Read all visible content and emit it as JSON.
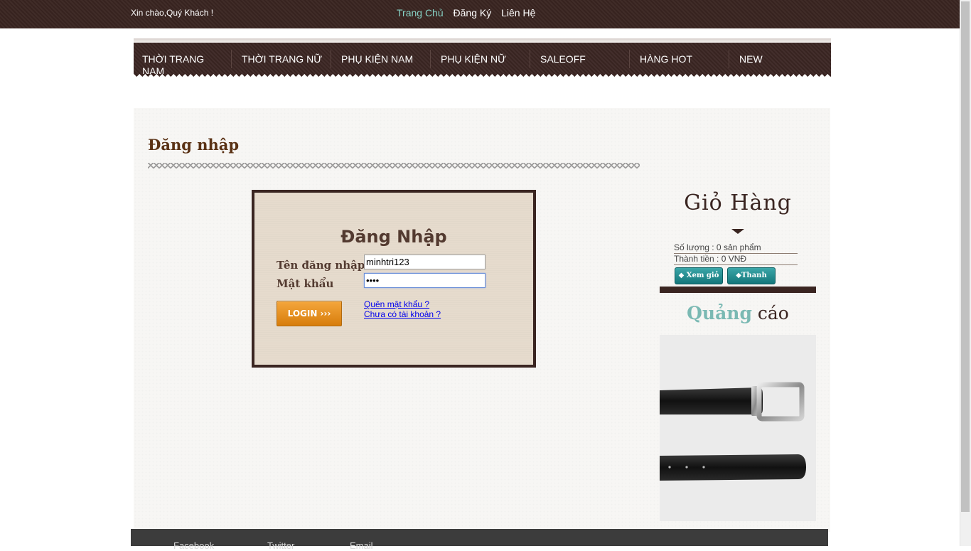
{
  "topbar": {
    "greeting": "Xin chào,Quý Khách !",
    "links": [
      "Trang Chủ",
      "Đăng Ký",
      "Liên Hệ"
    ],
    "active_color": "#86d1c4"
  },
  "nav": {
    "items": [
      "THỜI TRANG NAM",
      "THỜI TRANG NỮ",
      "PHỤ KIỆN NAM",
      "PHỤ KIỆN NỮ",
      "SALEOFF",
      "HÀNG HOT",
      "NEW"
    ]
  },
  "page": {
    "title": "Đăng nhập"
  },
  "login": {
    "heading": "Đăng Nhập",
    "username_label": "Tên đăng nhập",
    "username_value": "minhtri123",
    "password_label": "Mật khẩu",
    "password_value": "••••",
    "button": "LOGIN ›››",
    "forgot_link": "Quên mật khẩu ?",
    "register_link": "Chưa có tài khoản ?"
  },
  "cart": {
    "title": "Giỏ Hàng",
    "quantity": "Số lượng : 0 sản phẩm",
    "total": "Thành tiền : 0 VNĐ",
    "view_button": "Xem giỏ",
    "checkout_button": "Thanh toán"
  },
  "ads": {
    "title_part1": "Quảng",
    "title_part2": "cáo"
  },
  "footer": {
    "links": [
      "Facebook",
      "Twitter",
      "Email"
    ]
  },
  "colors": {
    "brown": "#3a2521",
    "teal": "#14777b",
    "orange": "#d77d0c"
  }
}
